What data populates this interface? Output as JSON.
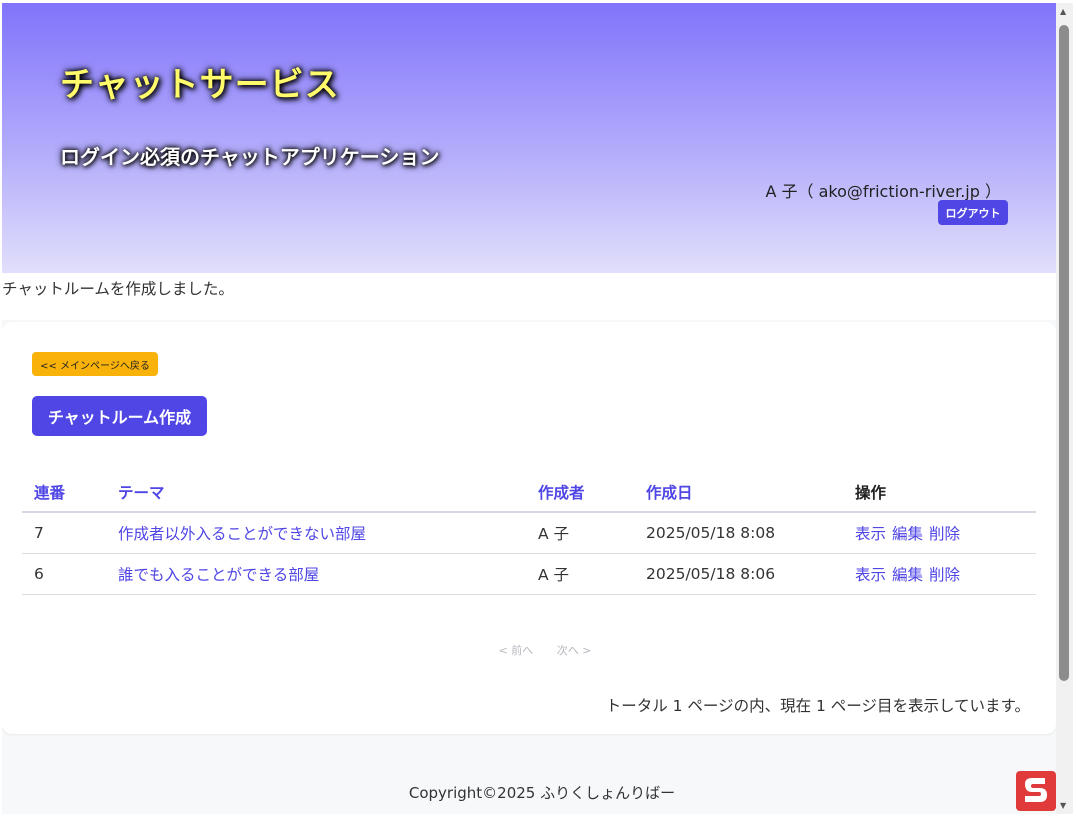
{
  "header": {
    "title": "チャットサービス",
    "subtitle": "ログイン必須のチャットアプリケーション",
    "user": "A 子（ ako@friction-river.jp ）",
    "logout_label": "ログアウト"
  },
  "flash_message": "チャットルームを作成しました。",
  "actions": {
    "back_label": "<< メインページへ戻る",
    "create_label": "チャットルーム作成"
  },
  "table": {
    "headers": {
      "id": "連番",
      "theme": "テーマ",
      "author": "作成者",
      "created": "作成日",
      "ops": "操作"
    },
    "rows": [
      {
        "id": "7",
        "theme": "作成者以外入ることができない部屋",
        "author": "A 子",
        "created": "2025/05/18 8:08",
        "show": "表示",
        "edit": "編集",
        "delete": "削除"
      },
      {
        "id": "6",
        "theme": "誰でも入ることができる部屋",
        "author": "A 子",
        "created": "2025/05/18 8:06",
        "show": "表示",
        "edit": "編集",
        "delete": "削除"
      }
    ]
  },
  "pagination": {
    "prev_label": "< 前へ",
    "next_label": "次へ >",
    "status": "トータル 1 ページの内、現在 1 ページ目を表示しています。"
  },
  "footer": {
    "copyright": "Copyright©2025 ふりくしょんりばー"
  },
  "colors": {
    "accent": "#4f46e5",
    "back_button": "#f9b209",
    "title_text": "#fffb6b",
    "hero_top": "#8174fb",
    "hero_bottom": "#e1dffb"
  },
  "icons": {
    "scroll_up": "scroll-up-arrow-icon",
    "scroll_down": "scroll-down-arrow-icon",
    "badge": "app-badge-icon"
  }
}
